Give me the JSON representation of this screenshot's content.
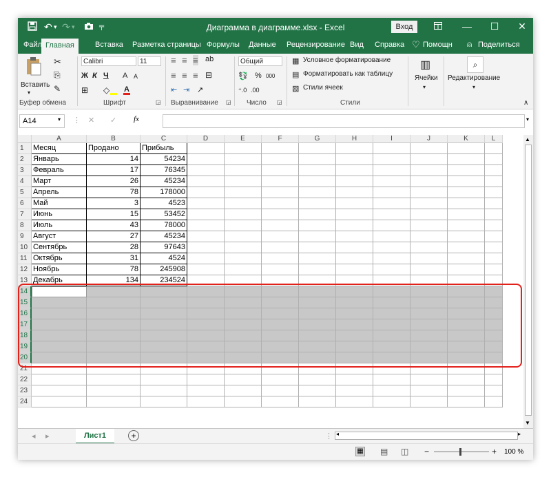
{
  "title_bar": {
    "title": "Диаграмма в диаграмме.xlsx  -  Excel",
    "login": "Вход",
    "save_icon": "save-icon",
    "undo_icon": "undo-icon",
    "redo_icon": "redo-icon",
    "camera_icon": "camera-icon",
    "customize_icon": "quick-access-customize-icon",
    "ribbon_display_icon": "ribbon-display-options-icon",
    "minimize_icon": "minimize-icon",
    "maximize_icon": "maximize-icon",
    "close_icon": "close-icon"
  },
  "menu": {
    "tabs": [
      "Файл",
      "Главная",
      "Вставка",
      "Разметка страницы",
      "Формулы",
      "Данные",
      "Рецензирование",
      "Вид",
      "Справка"
    ],
    "active_tab": "Главная",
    "help": "Помощн",
    "share": "Поделиться"
  },
  "ribbon": {
    "clipboard": {
      "paste": "Вставить",
      "label": "Буфер обмена"
    },
    "font": {
      "name": "Calibri",
      "size": "11",
      "bold": "Ж",
      "italic": "К",
      "underline": "Ч",
      "grow": "A",
      "shrink": "A",
      "label": "Шрифт"
    },
    "alignment": {
      "label": "Выравнивание"
    },
    "number": {
      "format": "Общий",
      "percent": "%",
      "thousands": "000",
      "label": "Число"
    },
    "styles": {
      "conditional": "Условное форматирование",
      "as_table": "Форматировать как таблицу",
      "cell_styles": "Стили ячеек",
      "label": "Стили"
    },
    "cells": {
      "label": "Ячейки"
    },
    "editing": {
      "label": "Редактирование"
    }
  },
  "formula_bar": {
    "name_box": "A14",
    "fx": "fx",
    "cancel": "✕",
    "enter": "✓",
    "value": ""
  },
  "columns": [
    "A",
    "B",
    "C",
    "D",
    "E",
    "F",
    "G",
    "H",
    "I",
    "J",
    "K",
    "L"
  ],
  "rows": [
    "1",
    "2",
    "3",
    "4",
    "5",
    "6",
    "7",
    "8",
    "9",
    "10",
    "11",
    "12",
    "13",
    "14",
    "15",
    "16",
    "17",
    "18",
    "19",
    "20",
    "21",
    "22",
    "23",
    "24"
  ],
  "table": {
    "headers": [
      "Месяц",
      "Продано",
      "Прибыль"
    ],
    "data": [
      [
        "Январь",
        "14",
        "54234"
      ],
      [
        "Февраль",
        "17",
        "76345"
      ],
      [
        "Март",
        "26",
        "45234"
      ],
      [
        "Апрель",
        "78",
        "178000"
      ],
      [
        "Май",
        "3",
        "4523"
      ],
      [
        "Июнь",
        "15",
        "53452"
      ],
      [
        "Июль",
        "43",
        "78000"
      ],
      [
        "Август",
        "27",
        "45234"
      ],
      [
        "Сентябрь",
        "28",
        "97643"
      ],
      [
        "Октябрь",
        "31",
        "4524"
      ],
      [
        "Ноябрь",
        "78",
        "245908"
      ],
      [
        "Декабрь",
        "134",
        "234524"
      ]
    ]
  },
  "selection": {
    "rows": "14:20",
    "highlight_color": "#e3211b"
  },
  "sheet_tabs": {
    "active": "Лист1",
    "add": "+"
  },
  "status_bar": {
    "zoom": "100 %",
    "minus": "−",
    "plus": "+"
  },
  "colors": {
    "excel_green": "#217346",
    "selection_gray": "#c8c8c8",
    "annotation_red": "#e3211b"
  }
}
